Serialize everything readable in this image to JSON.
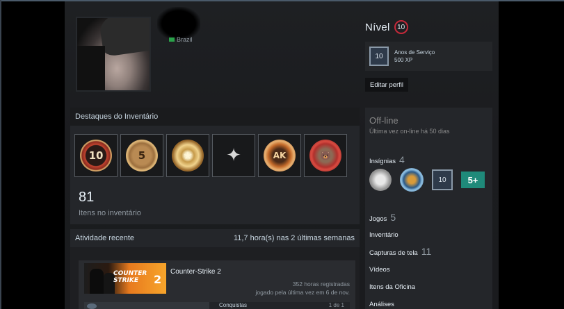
{
  "header": {
    "country": "Brazil"
  },
  "level": {
    "label": "Nível",
    "value": "10"
  },
  "featured_badge": {
    "icon_text": "10",
    "name": "Anos de Serviço",
    "xp": "500 XP"
  },
  "edit_profile_label": "Editar perfil",
  "showcase": {
    "title": "Destaques do Inventário",
    "items": [
      {
        "icon": "service-medal-10-icon",
        "text": "10"
      },
      {
        "icon": "service-medal-5-icon",
        "text": "5"
      },
      {
        "icon": "gold-star-coin-icon",
        "text": "★"
      },
      {
        "icon": "silver-star-pin-icon",
        "text": "✦"
      },
      {
        "icon": "ak-coin-icon",
        "text": "AK"
      },
      {
        "icon": "bear-pin-icon",
        "text": "🐻"
      }
    ],
    "count": "81",
    "count_label": "Itens no inventário"
  },
  "activity": {
    "title": "Atividade recente",
    "summary": "11,7 hora(s) nas 2 últimas semanas",
    "game": {
      "logo_text": "COUNTER STRIKE",
      "logo_number": "2",
      "title": "Counter-Strike 2",
      "hours": "352 horas registradas",
      "last_played": "jogado pela última vez em 6 de nov.",
      "achievements_label": "Conquistas",
      "achievements_count": "1 de 1"
    }
  },
  "sidebar": {
    "status": "Off-line",
    "last_seen": "Última vez on-line há 50 dias",
    "badges_label": "Insígnias",
    "badges_count": "4",
    "badge_icons": [
      "silver-coin-icon",
      "operation-coin-icon",
      "years-of-service-icon",
      "more-badges-icon"
    ],
    "more_badges": "5+",
    "years_badge_text": "10",
    "links": [
      {
        "label": "Jogos",
        "count": "5"
      },
      {
        "label": "Inventário",
        "count": ""
      },
      {
        "label": "Capturas de tela",
        "count": "11"
      },
      {
        "label": "Vídeos",
        "count": ""
      },
      {
        "label": "Itens da Oficina",
        "count": ""
      },
      {
        "label": "Análises",
        "count": ""
      }
    ]
  },
  "colors": {
    "page_bg": "#1b1c1f",
    "panel_bg": "#24262a",
    "level_ring": "#c5293a",
    "text_primary": "#e6eef5",
    "text_muted": "#8f98a0"
  }
}
